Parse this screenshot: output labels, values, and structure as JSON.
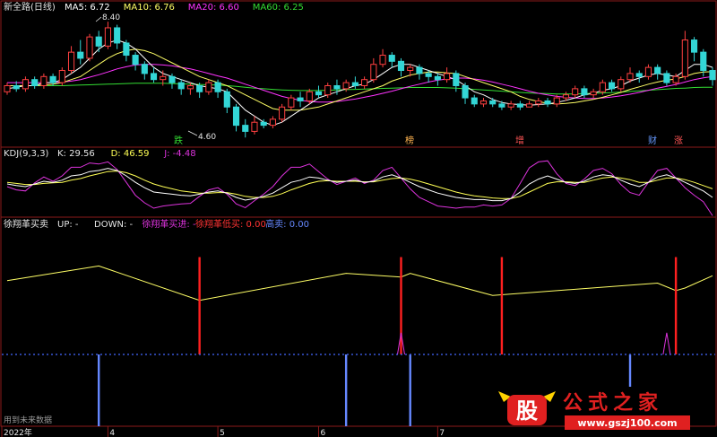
{
  "colors": {
    "background": "#000000",
    "border": "#8b1a1a",
    "title_white": "#e6e6e6",
    "ma5": "#ffffff",
    "ma10": "#ffff66",
    "ma20": "#ff33ff",
    "ma60": "#33dd33",
    "candle_up": "#ff4040",
    "candle_down": "#33d6d6",
    "kdj_k": "#ffffff",
    "kdj_d": "#ffff55",
    "kdj_j": "#dd33dd",
    "line_up": "#ffff66",
    "buy_bar": "#ff2020",
    "buy_low_bar": "#ff2020",
    "sell_bar": "#6688ff",
    "dotted_line": "#4466ff",
    "watermark_red": "#e02020",
    "watermark_yellow": "#ffd200"
  },
  "icons": {
    "logo": "gu-seal-icon"
  },
  "chart_data": [
    {
      "type": "candlestick",
      "name_text": "新全路(日线)",
      "legend": [
        {
          "label": "MA5: 6.72",
          "color": "#ffffff"
        },
        {
          "label": "MA10: 6.76",
          "color": "#ffff66"
        },
        {
          "label": "MA20: 6.60",
          "color": "#ff33ff"
        },
        {
          "label": "MA60: 6.25",
          "color": "#33dd33"
        }
      ],
      "high_label": "8.40",
      "low_label": "4.60",
      "event_tags": [
        {
          "text": "跌",
          "color": "#33dd33"
        },
        {
          "text": "榜",
          "color": "#ffb450"
        },
        {
          "text": "增",
          "color": "#ff5555"
        },
        {
          "text": "财",
          "color": "#6699ff"
        },
        {
          "text": "涨",
          "color": "#ff5555"
        }
      ],
      "ylim": [
        4.4,
        8.7
      ],
      "candles": [
        [
          6.1,
          6.3,
          6.0,
          6.4
        ],
        [
          6.3,
          6.2,
          6.1,
          6.45
        ],
        [
          6.2,
          6.5,
          6.1,
          6.6
        ],
        [
          6.5,
          6.3,
          6.2,
          6.6
        ],
        [
          6.3,
          6.6,
          6.2,
          6.7
        ],
        [
          6.6,
          6.4,
          6.3,
          6.7
        ],
        [
          6.4,
          6.8,
          6.3,
          6.9
        ],
        [
          6.8,
          7.4,
          6.7,
          7.6
        ],
        [
          7.4,
          7.2,
          7.0,
          7.8
        ],
        [
          7.2,
          7.9,
          7.1,
          8.0
        ],
        [
          7.9,
          7.6,
          7.4,
          8.1
        ],
        [
          7.6,
          8.2,
          7.5,
          8.4
        ],
        [
          8.2,
          7.7,
          7.5,
          8.3
        ],
        [
          7.7,
          7.3,
          7.1,
          7.8
        ],
        [
          7.3,
          7.0,
          6.8,
          7.4
        ],
        [
          7.0,
          6.7,
          6.5,
          7.1
        ],
        [
          6.7,
          6.5,
          6.4,
          6.9
        ],
        [
          6.5,
          6.6,
          6.3,
          6.8
        ],
        [
          6.6,
          6.4,
          6.2,
          6.7
        ],
        [
          6.4,
          6.2,
          6.0,
          6.5
        ],
        [
          6.2,
          6.3,
          6.0,
          6.4
        ],
        [
          6.3,
          6.1,
          5.9,
          6.4
        ],
        [
          6.1,
          6.4,
          6.0,
          6.5
        ],
        [
          6.4,
          6.1,
          5.9,
          6.5
        ],
        [
          6.1,
          5.6,
          5.4,
          6.2
        ],
        [
          5.6,
          5.0,
          4.8,
          5.7
        ],
        [
          5.0,
          4.8,
          4.6,
          5.2
        ],
        [
          4.8,
          5.1,
          4.7,
          5.3
        ],
        [
          5.1,
          5.0,
          4.9,
          5.2
        ],
        [
          5.0,
          5.2,
          4.9,
          5.3
        ],
        [
          5.2,
          5.6,
          5.1,
          5.7
        ],
        [
          5.6,
          5.9,
          5.5,
          6.0
        ],
        [
          5.9,
          5.8,
          5.6,
          6.1
        ],
        [
          5.8,
          6.1,
          5.7,
          6.2
        ],
        [
          6.1,
          6.0,
          5.9,
          6.3
        ],
        [
          6.0,
          6.3,
          5.9,
          6.4
        ],
        [
          6.3,
          6.2,
          6.0,
          6.5
        ],
        [
          6.2,
          6.4,
          6.1,
          6.5
        ],
        [
          6.4,
          6.3,
          6.2,
          6.6
        ],
        [
          6.3,
          6.5,
          6.2,
          6.6
        ],
        [
          6.5,
          7.0,
          6.4,
          7.2
        ],
        [
          7.0,
          7.3,
          6.9,
          7.5
        ],
        [
          7.3,
          7.1,
          6.9,
          7.4
        ],
        [
          7.1,
          6.8,
          6.6,
          7.2
        ],
        [
          6.8,
          6.9,
          6.6,
          7.0
        ],
        [
          6.9,
          6.7,
          6.5,
          7.0
        ],
        [
          6.7,
          6.6,
          6.4,
          6.8
        ],
        [
          6.6,
          6.5,
          6.3,
          6.7
        ],
        [
          6.5,
          6.7,
          6.4,
          6.9
        ],
        [
          6.7,
          6.3,
          6.1,
          6.8
        ],
        [
          6.3,
          5.9,
          5.7,
          6.4
        ],
        [
          5.9,
          5.7,
          5.6,
          6.0
        ],
        [
          5.7,
          5.8,
          5.6,
          5.9
        ],
        [
          5.8,
          5.7,
          5.6,
          5.9
        ],
        [
          5.7,
          5.6,
          5.5,
          5.8
        ],
        [
          5.6,
          5.7,
          5.5,
          5.8
        ],
        [
          5.7,
          5.6,
          5.5,
          5.8
        ],
        [
          5.6,
          5.7,
          5.6,
          5.8
        ],
        [
          5.7,
          5.8,
          5.6,
          5.9
        ],
        [
          5.8,
          5.7,
          5.6,
          5.9
        ],
        [
          5.7,
          5.9,
          5.6,
          6.0
        ],
        [
          5.9,
          6.0,
          5.8,
          6.1
        ],
        [
          6.0,
          6.2,
          5.9,
          6.3
        ],
        [
          6.2,
          6.0,
          5.9,
          6.3
        ],
        [
          6.0,
          6.1,
          5.9,
          6.2
        ],
        [
          6.1,
          6.4,
          6.0,
          6.5
        ],
        [
          6.4,
          6.2,
          6.1,
          6.5
        ],
        [
          6.2,
          6.5,
          6.1,
          6.6
        ],
        [
          6.5,
          6.7,
          6.4,
          6.9
        ],
        [
          6.7,
          6.6,
          6.4,
          6.8
        ],
        [
          6.6,
          6.9,
          6.5,
          7.0
        ],
        [
          6.9,
          6.7,
          6.5,
          7.0
        ],
        [
          6.7,
          6.4,
          6.3,
          6.8
        ],
        [
          6.4,
          6.6,
          6.3,
          6.7
        ],
        [
          6.6,
          7.8,
          6.5,
          8.1
        ],
        [
          7.8,
          7.4,
          7.1,
          7.9
        ],
        [
          7.4,
          6.8,
          6.6,
          7.5
        ],
        [
          6.8,
          6.5,
          6.3,
          6.9
        ]
      ],
      "ma5": [
        6.2,
        6.25,
        6.3,
        6.3,
        6.4,
        6.4,
        6.5,
        6.7,
        6.9,
        7.2,
        7.5,
        7.7,
        7.8,
        7.7,
        7.5,
        7.2,
        6.9,
        6.7,
        6.6,
        6.5,
        6.4,
        6.3,
        6.25,
        6.2,
        6.1,
        5.8,
        5.5,
        5.3,
        5.1,
        5.0,
        5.1,
        5.3,
        5.5,
        5.7,
        5.9,
        6.0,
        6.1,
        6.2,
        6.3,
        6.35,
        6.5,
        6.7,
        6.9,
        7.0,
        7.0,
        6.9,
        6.8,
        6.7,
        6.6,
        6.5,
        6.3,
        6.1,
        6.0,
        5.85,
        5.75,
        5.7,
        5.68,
        5.66,
        5.68,
        5.7,
        5.75,
        5.82,
        5.9,
        6.0,
        6.05,
        6.15,
        6.2,
        6.3,
        6.45,
        6.55,
        6.65,
        6.7,
        6.65,
        6.6,
        6.8,
        7.0,
        7.0,
        6.9
      ],
      "ma10": [
        6.3,
        6.3,
        6.3,
        6.3,
        6.32,
        6.35,
        6.4,
        6.5,
        6.6,
        6.8,
        7.0,
        7.2,
        7.35,
        7.45,
        7.5,
        7.45,
        7.35,
        7.2,
        7.05,
        6.9,
        6.75,
        6.6,
        6.5,
        6.4,
        6.3,
        6.15,
        6.0,
        5.85,
        5.7,
        5.55,
        5.5,
        5.5,
        5.5,
        5.55,
        5.6,
        5.7,
        5.8,
        5.9,
        6.0,
        6.1,
        6.2,
        6.3,
        6.45,
        6.55,
        6.65,
        6.7,
        6.75,
        6.75,
        6.72,
        6.7,
        6.6,
        6.5,
        6.4,
        6.3,
        6.2,
        6.1,
        5.95,
        5.85,
        5.78,
        5.72,
        5.7,
        5.72,
        5.75,
        5.8,
        5.85,
        5.92,
        6.0,
        6.08,
        6.18,
        6.26,
        6.35,
        6.42,
        6.48,
        6.52,
        6.6,
        6.7,
        6.75,
        6.76
      ],
      "ma20": [
        6.4,
        6.4,
        6.4,
        6.4,
        6.4,
        6.4,
        6.42,
        6.45,
        6.5,
        6.58,
        6.66,
        6.75,
        6.85,
        6.92,
        6.98,
        7.0,
        7.0,
        6.98,
        6.95,
        6.9,
        6.85,
        6.78,
        6.7,
        6.62,
        6.55,
        6.45,
        6.35,
        6.25,
        6.15,
        6.05,
        5.95,
        5.88,
        5.82,
        5.78,
        5.76,
        5.76,
        5.78,
        5.82,
        5.86,
        5.92,
        5.98,
        6.05,
        6.12,
        6.2,
        6.28,
        6.35,
        6.42,
        6.48,
        6.52,
        6.55,
        6.55,
        6.52,
        6.48,
        6.42,
        6.35,
        6.28,
        6.2,
        6.12,
        6.05,
        6.0,
        5.95,
        5.92,
        5.9,
        5.88,
        5.88,
        5.9,
        5.93,
        5.97,
        6.02,
        6.08,
        6.15,
        6.22,
        6.28,
        6.34,
        6.42,
        6.5,
        6.56,
        6.6
      ],
      "ma60": [
        6.3,
        6.3,
        6.3,
        6.3,
        6.3,
        6.3,
        6.3,
        6.31,
        6.32,
        6.33,
        6.34,
        6.35,
        6.36,
        6.37,
        6.38,
        6.38,
        6.38,
        6.38,
        6.37,
        6.36,
        6.35,
        6.34,
        6.33,
        6.32,
        6.3,
        6.28,
        6.25,
        6.22,
        6.2,
        6.18,
        6.16,
        6.15,
        6.14,
        6.14,
        6.14,
        6.15,
        6.16,
        6.17,
        6.18,
        6.19,
        6.2,
        6.21,
        6.22,
        6.23,
        6.24,
        6.24,
        6.24,
        6.24,
        6.23,
        6.22,
        6.2,
        6.18,
        6.16,
        6.14,
        6.12,
        6.1,
        6.08,
        6.06,
        6.05,
        6.04,
        6.03,
        6.03,
        6.03,
        6.04,
        6.05,
        6.06,
        6.07,
        6.09,
        6.11,
        6.13,
        6.15,
        6.17,
        6.19,
        6.21,
        6.22,
        6.24,
        6.25,
        6.25
      ]
    },
    {
      "type": "line",
      "name_text": "KDJ(9,3,3)",
      "legend": [
        {
          "label": "K: 29.56",
          "color": "#e6e6e6"
        },
        {
          "label": "D: 46.59",
          "color": "#ffff55"
        },
        {
          "label": "J: -4.48",
          "color": "#dd33dd"
        }
      ],
      "ylim": [
        0,
        100
      ],
      "k": [
        55,
        52,
        50,
        55,
        60,
        58,
        62,
        70,
        72,
        78,
        80,
        84,
        80,
        70,
        58,
        48,
        40,
        38,
        36,
        34,
        33,
        36,
        40,
        42,
        38,
        30,
        25,
        28,
        32,
        38,
        48,
        58,
        62,
        68,
        66,
        62,
        58,
        60,
        62,
        58,
        60,
        68,
        72,
        66,
        58,
        50,
        44,
        38,
        34,
        30,
        28,
        26,
        26,
        24,
        24,
        28,
        40,
        55,
        64,
        70,
        64,
        58,
        56,
        60,
        68,
        72,
        70,
        62,
        55,
        50,
        58,
        68,
        72,
        66,
        58,
        50,
        42,
        30
      ],
      "d": [
        58,
        56,
        54,
        54,
        56,
        57,
        58,
        62,
        65,
        70,
        74,
        78,
        79,
        76,
        70,
        62,
        55,
        50,
        46,
        42,
        40,
        38,
        38,
        39,
        39,
        36,
        32,
        30,
        30,
        32,
        37,
        44,
        50,
        56,
        60,
        61,
        60,
        60,
        60,
        59,
        59,
        62,
        65,
        66,
        64,
        60,
        55,
        50,
        45,
        40,
        36,
        33,
        31,
        29,
        28,
        28,
        32,
        40,
        48,
        56,
        59,
        59,
        58,
        58,
        62,
        66,
        68,
        66,
        63,
        58,
        58,
        62,
        66,
        66,
        63,
        58,
        52,
        46
      ],
      "j": [
        50,
        44,
        42,
        57,
        68,
        60,
        70,
        86,
        86,
        94,
        92,
        96,
        82,
        58,
        34,
        20,
        10,
        14,
        16,
        18,
        19,
        32,
        44,
        48,
        36,
        18,
        11,
        24,
        36,
        50,
        70,
        86,
        86,
        92,
        78,
        64,
        54,
        60,
        66,
        56,
        62,
        80,
        86,
        66,
        46,
        30,
        22,
        14,
        12,
        10,
        12,
        12,
        16,
        14,
        16,
        28,
        56,
        85,
        96,
        98,
        74,
        56,
        52,
        64,
        80,
        84,
        74,
        54,
        39,
        34,
        58,
        80,
        84,
        66,
        48,
        34,
        22,
        -4
      ]
    },
    {
      "type": "line",
      "name_text": "徐翔革买卖",
      "legend": [
        {
          "label": "UP: -",
          "color": "#e6e6e6"
        },
        {
          "label": "DOWN: -",
          "color": "#e6e6e6"
        },
        {
          "label": "徐翔革买进: -",
          "color": "#dd33dd"
        },
        {
          "label": "徐翔革低买: 0.00",
          "color": "#ff3333"
        },
        {
          "label": "高卖: 0.00",
          "color": "#6688ff"
        }
      ],
      "up_line": [
        [
          0,
          60
        ],
        [
          10,
          72
        ],
        [
          21,
          44
        ],
        [
          37,
          66
        ],
        [
          43,
          63
        ],
        [
          44,
          66
        ],
        [
          53,
          48
        ],
        [
          71,
          58
        ],
        [
          73,
          52
        ],
        [
          74,
          54
        ],
        [
          77,
          64
        ]
      ],
      "buy_bars": [
        {
          "i": 21,
          "h": 36
        },
        {
          "i": 43,
          "h": 36
        },
        {
          "i": 54,
          "h": 36
        },
        {
          "i": 73,
          "h": 36
        }
      ],
      "low_buy_spikes": [
        {
          "i": 43,
          "h": 8
        },
        {
          "i": 72,
          "h": 8
        }
      ],
      "sell_bars": [
        {
          "i": 10,
          "h": 40
        },
        {
          "i": 37,
          "h": 40
        },
        {
          "i": 44,
          "h": 40
        },
        {
          "i": 68,
          "h": 18
        }
      ],
      "ylim": [
        0,
        100
      ],
      "footnote": "用到未来数据"
    }
  ],
  "x_axis": {
    "labels": [
      {
        "text": "2022年",
        "i": 0
      },
      {
        "text": "4",
        "i": 11
      },
      {
        "text": "5",
        "i": 23
      },
      {
        "text": "6",
        "i": 34
      },
      {
        "text": "7",
        "i": 47
      }
    ]
  },
  "watermark": {
    "logo_char": "股",
    "text": "公式之家",
    "url": "www.gszj100.com"
  }
}
